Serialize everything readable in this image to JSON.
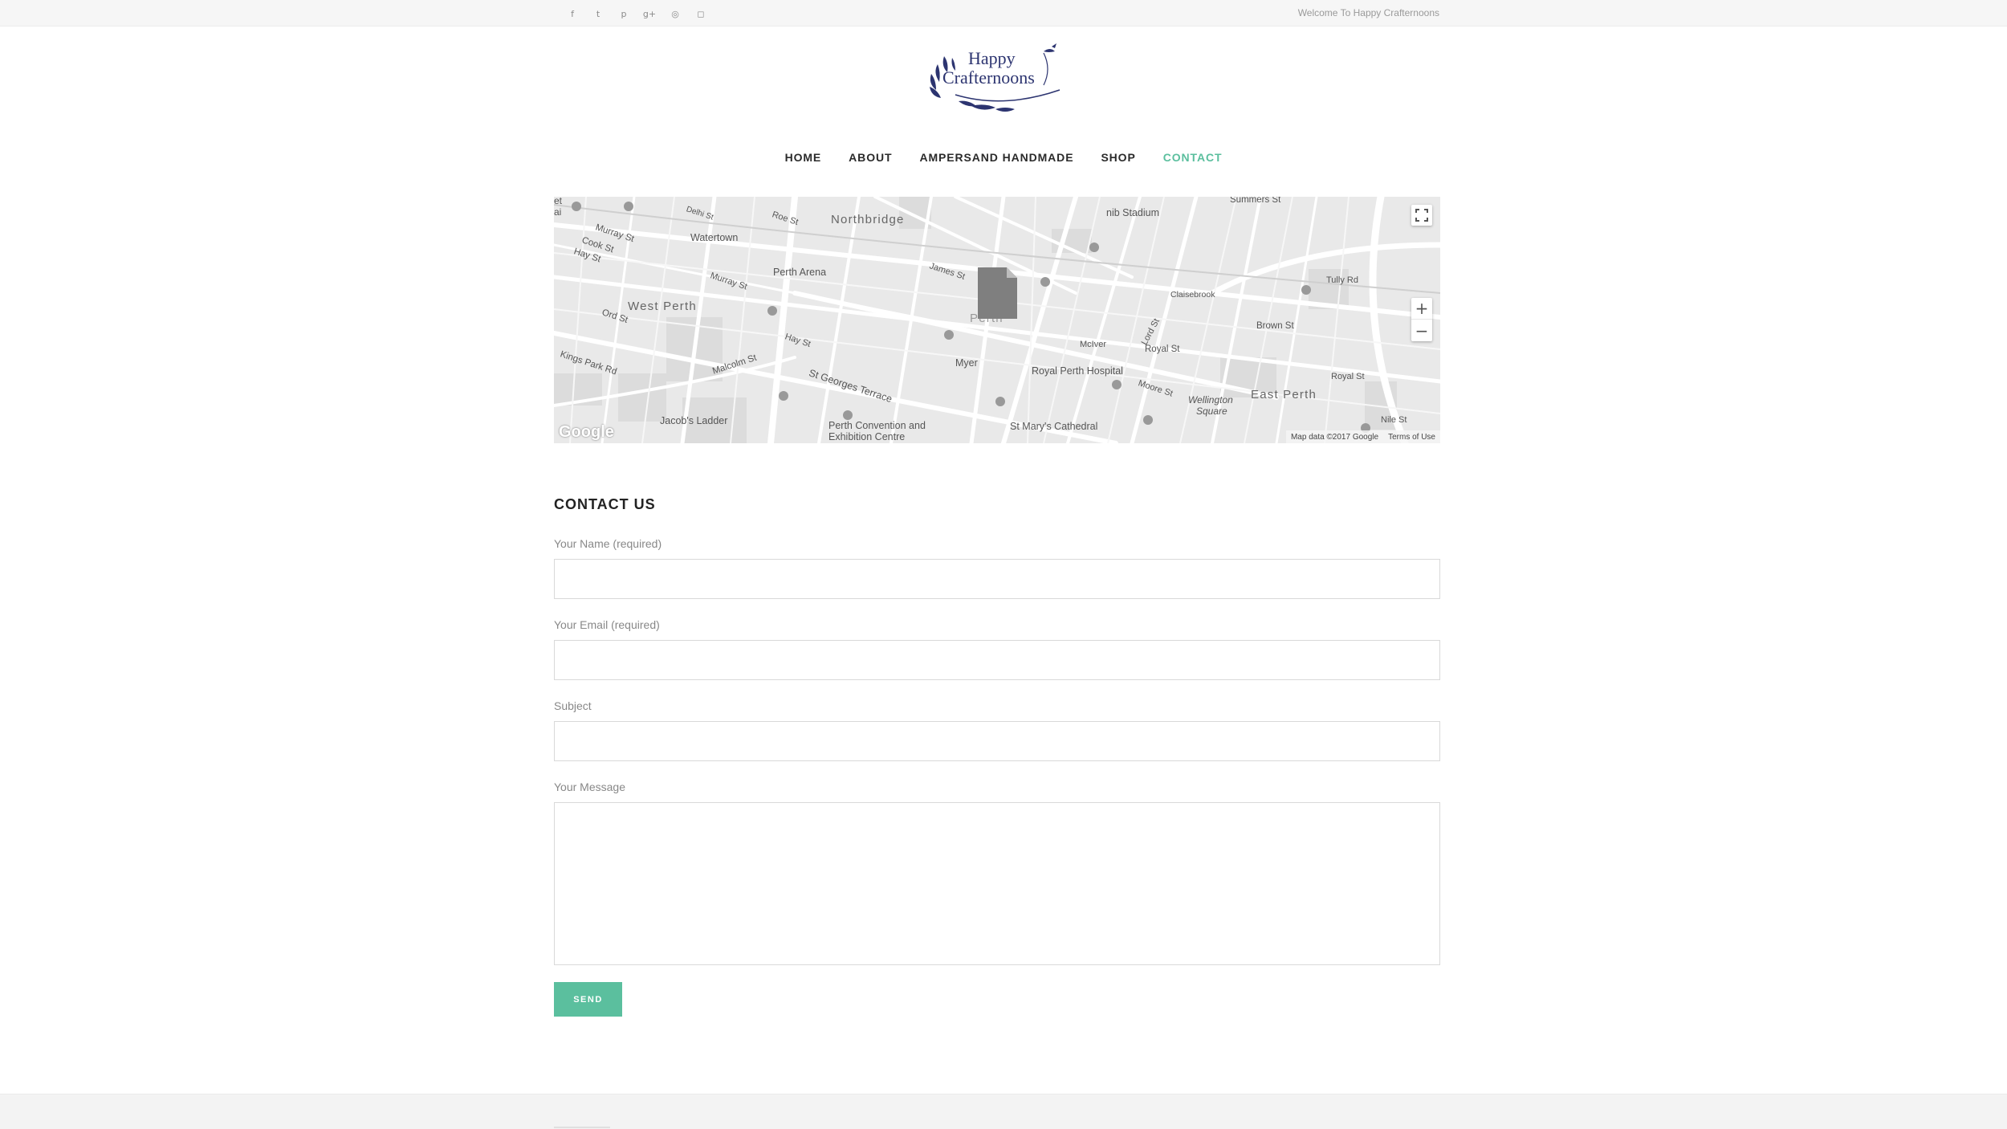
{
  "topbar": {
    "social_icons": [
      {
        "name": "facebook-icon",
        "glyph": "f"
      },
      {
        "name": "twitter-icon",
        "glyph": "t"
      },
      {
        "name": "pinterest-icon",
        "glyph": "p"
      },
      {
        "name": "google-plus-icon",
        "glyph": "g+"
      },
      {
        "name": "dribbble-icon",
        "glyph": "◎"
      },
      {
        "name": "instagram-icon",
        "glyph": "◻"
      }
    ],
    "welcome_text": "Welcome To Happy Crafternoons"
  },
  "logo": {
    "line1": "Happy",
    "line2": "Crafternoons",
    "color": "#2c3470"
  },
  "nav": {
    "items": [
      "HOME",
      "ABOUT",
      "AMPERSAND HANDMADE",
      "SHOP",
      "CONTACT"
    ],
    "active_index": 4,
    "active_color": "#5bbf9e"
  },
  "map": {
    "labels": {
      "northbridge": "Northbridge",
      "west_perth": "West Perth",
      "perth": "Perth",
      "east_perth": "East Perth",
      "watertown": "Watertown",
      "perth_arena": "Perth Arena",
      "nib_stadium": "nib Stadium",
      "summers_st": "Summers St",
      "murray_st_w": "Murray St",
      "cook_st": "Cook St",
      "hay_st_w": "Hay St",
      "ord_st": "Ord St",
      "kings_park_rd": "Kings Park Rd",
      "malcolm_st": "Malcolm St",
      "jacobs_ladder": "Jacob's Ladder",
      "st_georges_terrace": "St Georges Terrace",
      "perth_convention_1": "Perth Convention and",
      "perth_convention_2": "Exhibition Centre",
      "st_marys": "St Mary's Cathedral",
      "royal_perth_hospital": "Royal Perth Hospital",
      "myer": "Myer",
      "mciver": "McIver",
      "royal_st": "Royal St",
      "brown_st": "Brown St",
      "claisebrook": "Claisebrook",
      "wellington_1": "Wellington",
      "wellington_2": "Square",
      "tully_rd": "Tully Rd",
      "royal_st_e": "Royal St",
      "nile_st": "Nile St",
      "moore_st": "Moore St",
      "lord_st": "Lord St",
      "james_st": "James St",
      "roe_st": "Roe St",
      "delhi_st": "Delhi St",
      "murray_st_c": "Murray St",
      "hay_st_c": "Hay St",
      "edge_top": "et",
      "edge_mid": "ai"
    },
    "google_logo": "Google",
    "map_data": "Map data ©2017 Google",
    "terms": "Terms of Use",
    "zoom_in": "+",
    "zoom_out": "−"
  },
  "contact": {
    "title": "CONTACT US",
    "fields": {
      "name_label": "Your Name (required)",
      "email_label": "Your Email (required)",
      "subject_label": "Subject",
      "message_label": "Your Message",
      "name_value": "",
      "email_value": "",
      "subject_value": "",
      "message_value": ""
    },
    "send_label": "SEND",
    "send_color": "#5bbf9e"
  }
}
